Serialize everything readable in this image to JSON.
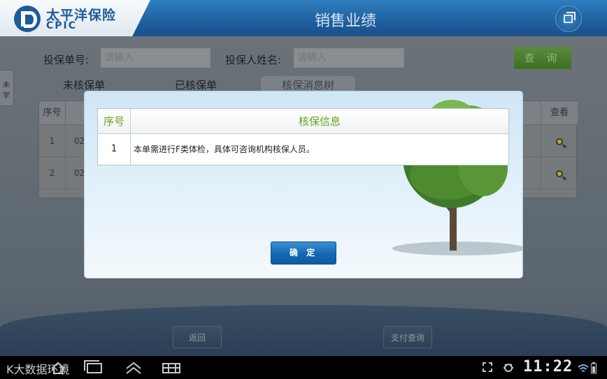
{
  "header": {
    "logo_cn": "太平洋保险",
    "logo_en": "CPIC",
    "title": "销售业绩"
  },
  "search": {
    "policy_no_label": "投保单号:",
    "policy_no_placeholder": "请输入",
    "holder_label": "投保人姓名:",
    "holder_placeholder": "请输入",
    "query_button": "查 询"
  },
  "side_tab": "未学",
  "tabs": [
    {
      "label": "未核保单"
    },
    {
      "label": "已核保单"
    },
    {
      "label": "核保消息树"
    }
  ],
  "table": {
    "headers": {
      "index": "序号",
      "view": "查看"
    },
    "rows": [
      {
        "index": "1",
        "code": "02"
      },
      {
        "index": "2",
        "code": "02"
      }
    ]
  },
  "footer": {
    "back_button": "返回",
    "pay_query_button": "支付查询"
  },
  "dialog": {
    "col_index": "序号",
    "col_info": "核保信息",
    "rows": [
      {
        "index": "1",
        "info": "本单需进行F类体检，具体可咨询机构核保人员。"
      }
    ],
    "confirm_button": "确 定"
  },
  "statusbar": {
    "watermark": "K大数据环境",
    "time": "11:22"
  }
}
